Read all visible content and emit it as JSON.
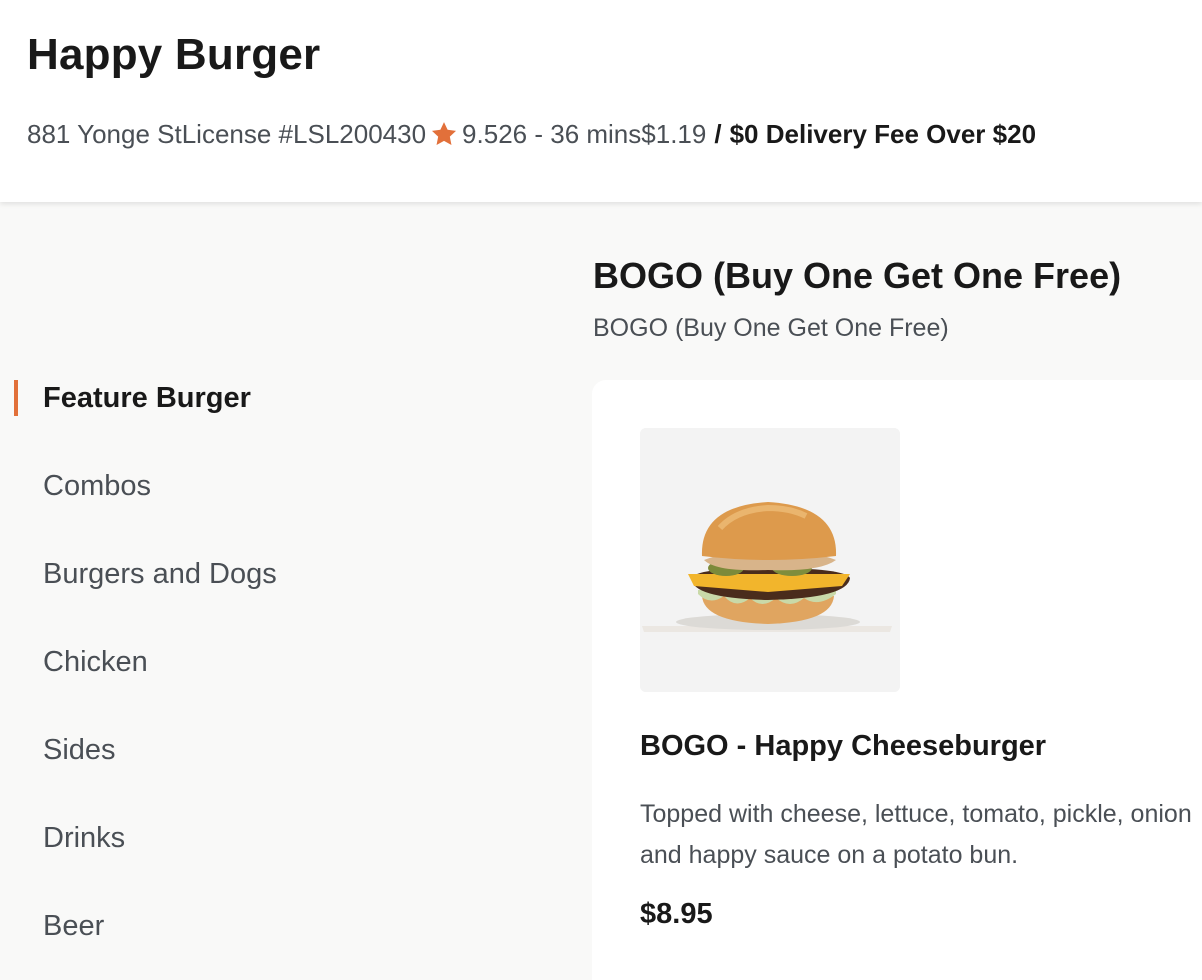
{
  "store": {
    "name": "Happy Burger",
    "address": "881 Yonge St",
    "license": "License #LSL200430",
    "star_icon": "star-icon",
    "rating": "9.5",
    "eta": "26 - 36 mins",
    "delivery_fee": "$1.19",
    "fee_separator": "/",
    "delivery_promo": "$0 Delivery Fee Over $20"
  },
  "colors": {
    "accent": "#e2703a",
    "text_primary": "#191919",
    "text_secondary": "#4a4f55",
    "page_bg": "#f9f9f8"
  },
  "categories": [
    {
      "label": "Feature Burger",
      "active": true
    },
    {
      "label": "Combos"
    },
    {
      "label": "Burgers and Dogs"
    },
    {
      "label": "Chicken"
    },
    {
      "label": "Sides"
    },
    {
      "label": "Drinks"
    },
    {
      "label": "Beer"
    }
  ],
  "section": {
    "title": "BOGO (Buy One Get One Free)",
    "subtitle": "BOGO (Buy One Get One Free)"
  },
  "items": [
    {
      "name": "BOGO - Happy Cheeseburger",
      "description": "Topped with cheese, lettuce, tomato, pickle, onion and happy sauce on a potato bun.",
      "price": "$8.95"
    }
  ]
}
